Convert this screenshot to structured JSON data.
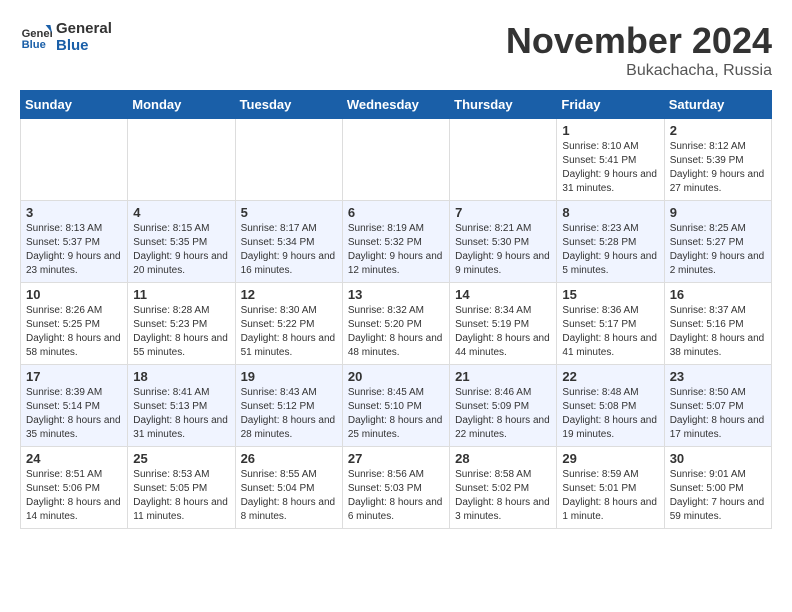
{
  "logo": {
    "general": "General",
    "blue": "Blue"
  },
  "header": {
    "month": "November 2024",
    "location": "Bukachacha, Russia"
  },
  "weekdays": [
    "Sunday",
    "Monday",
    "Tuesday",
    "Wednesday",
    "Thursday",
    "Friday",
    "Saturday"
  ],
  "weeks": [
    [
      {
        "day": "",
        "info": ""
      },
      {
        "day": "",
        "info": ""
      },
      {
        "day": "",
        "info": ""
      },
      {
        "day": "",
        "info": ""
      },
      {
        "day": "",
        "info": ""
      },
      {
        "day": "1",
        "info": "Sunrise: 8:10 AM\nSunset: 5:41 PM\nDaylight: 9 hours and 31 minutes."
      },
      {
        "day": "2",
        "info": "Sunrise: 8:12 AM\nSunset: 5:39 PM\nDaylight: 9 hours and 27 minutes."
      }
    ],
    [
      {
        "day": "3",
        "info": "Sunrise: 8:13 AM\nSunset: 5:37 PM\nDaylight: 9 hours and 23 minutes."
      },
      {
        "day": "4",
        "info": "Sunrise: 8:15 AM\nSunset: 5:35 PM\nDaylight: 9 hours and 20 minutes."
      },
      {
        "day": "5",
        "info": "Sunrise: 8:17 AM\nSunset: 5:34 PM\nDaylight: 9 hours and 16 minutes."
      },
      {
        "day": "6",
        "info": "Sunrise: 8:19 AM\nSunset: 5:32 PM\nDaylight: 9 hours and 12 minutes."
      },
      {
        "day": "7",
        "info": "Sunrise: 8:21 AM\nSunset: 5:30 PM\nDaylight: 9 hours and 9 minutes."
      },
      {
        "day": "8",
        "info": "Sunrise: 8:23 AM\nSunset: 5:28 PM\nDaylight: 9 hours and 5 minutes."
      },
      {
        "day": "9",
        "info": "Sunrise: 8:25 AM\nSunset: 5:27 PM\nDaylight: 9 hours and 2 minutes."
      }
    ],
    [
      {
        "day": "10",
        "info": "Sunrise: 8:26 AM\nSunset: 5:25 PM\nDaylight: 8 hours and 58 minutes."
      },
      {
        "day": "11",
        "info": "Sunrise: 8:28 AM\nSunset: 5:23 PM\nDaylight: 8 hours and 55 minutes."
      },
      {
        "day": "12",
        "info": "Sunrise: 8:30 AM\nSunset: 5:22 PM\nDaylight: 8 hours and 51 minutes."
      },
      {
        "day": "13",
        "info": "Sunrise: 8:32 AM\nSunset: 5:20 PM\nDaylight: 8 hours and 48 minutes."
      },
      {
        "day": "14",
        "info": "Sunrise: 8:34 AM\nSunset: 5:19 PM\nDaylight: 8 hours and 44 minutes."
      },
      {
        "day": "15",
        "info": "Sunrise: 8:36 AM\nSunset: 5:17 PM\nDaylight: 8 hours and 41 minutes."
      },
      {
        "day": "16",
        "info": "Sunrise: 8:37 AM\nSunset: 5:16 PM\nDaylight: 8 hours and 38 minutes."
      }
    ],
    [
      {
        "day": "17",
        "info": "Sunrise: 8:39 AM\nSunset: 5:14 PM\nDaylight: 8 hours and 35 minutes."
      },
      {
        "day": "18",
        "info": "Sunrise: 8:41 AM\nSunset: 5:13 PM\nDaylight: 8 hours and 31 minutes."
      },
      {
        "day": "19",
        "info": "Sunrise: 8:43 AM\nSunset: 5:12 PM\nDaylight: 8 hours and 28 minutes."
      },
      {
        "day": "20",
        "info": "Sunrise: 8:45 AM\nSunset: 5:10 PM\nDaylight: 8 hours and 25 minutes."
      },
      {
        "day": "21",
        "info": "Sunrise: 8:46 AM\nSunset: 5:09 PM\nDaylight: 8 hours and 22 minutes."
      },
      {
        "day": "22",
        "info": "Sunrise: 8:48 AM\nSunset: 5:08 PM\nDaylight: 8 hours and 19 minutes."
      },
      {
        "day": "23",
        "info": "Sunrise: 8:50 AM\nSunset: 5:07 PM\nDaylight: 8 hours and 17 minutes."
      }
    ],
    [
      {
        "day": "24",
        "info": "Sunrise: 8:51 AM\nSunset: 5:06 PM\nDaylight: 8 hours and 14 minutes."
      },
      {
        "day": "25",
        "info": "Sunrise: 8:53 AM\nSunset: 5:05 PM\nDaylight: 8 hours and 11 minutes."
      },
      {
        "day": "26",
        "info": "Sunrise: 8:55 AM\nSunset: 5:04 PM\nDaylight: 8 hours and 8 minutes."
      },
      {
        "day": "27",
        "info": "Sunrise: 8:56 AM\nSunset: 5:03 PM\nDaylight: 8 hours and 6 minutes."
      },
      {
        "day": "28",
        "info": "Sunrise: 8:58 AM\nSunset: 5:02 PM\nDaylight: 8 hours and 3 minutes."
      },
      {
        "day": "29",
        "info": "Sunrise: 8:59 AM\nSunset: 5:01 PM\nDaylight: 8 hours and 1 minute."
      },
      {
        "day": "30",
        "info": "Sunrise: 9:01 AM\nSunset: 5:00 PM\nDaylight: 7 hours and 59 minutes."
      }
    ]
  ]
}
